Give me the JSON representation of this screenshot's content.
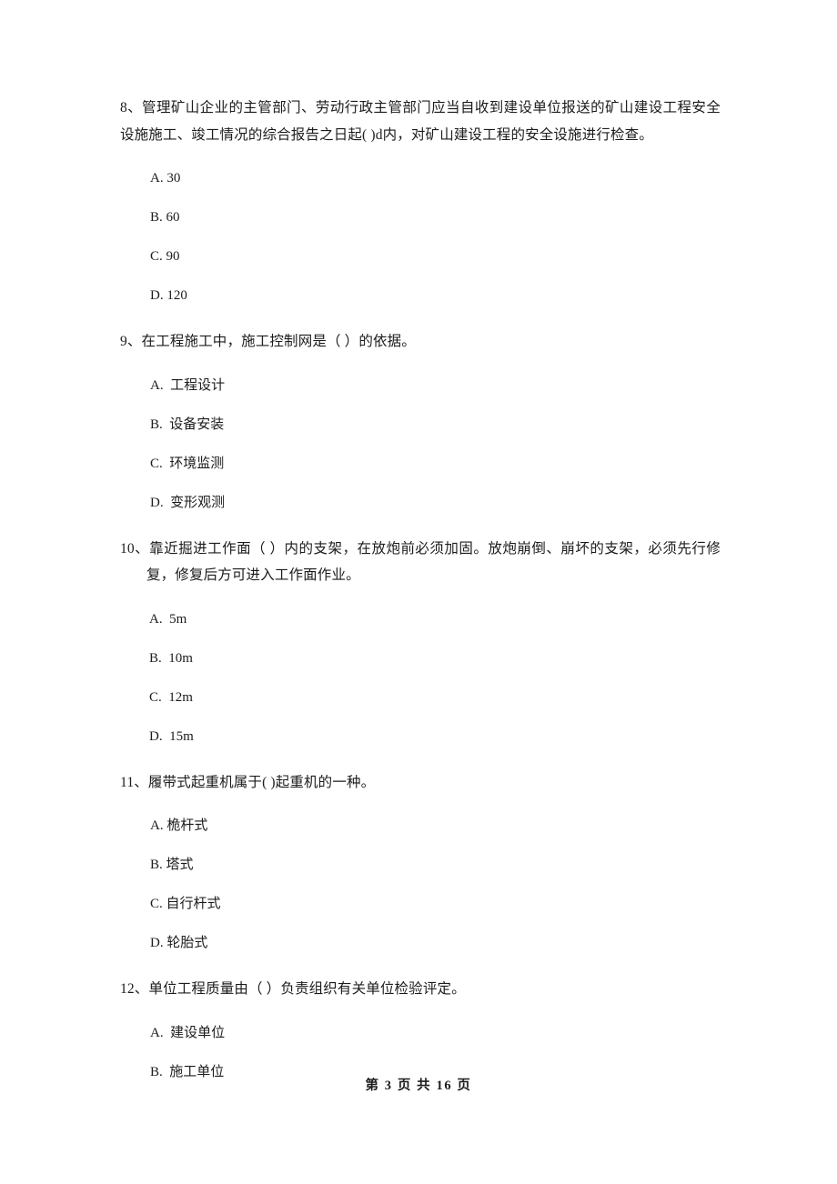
{
  "document": {
    "page_label": "第 3 页 共 16 页",
    "page_number": "3",
    "total_pages": "16",
    "text_color": "#1c1c1c",
    "background_color": "#ffffff"
  },
  "questions": [
    {
      "id": "q8",
      "number": "8、",
      "stem": "8、管理矿山企业的主管部门、劳动行政主管部门应当自收到建设单位报送的矿山建设工程安全设施施工、竣工情况的综合报告之日起(      )d内，对矿山建设工程的安全设施进行检查。",
      "hanging": false,
      "options": [
        {
          "key": "A",
          "label": "A. 30"
        },
        {
          "key": "B",
          "label": "B. 60"
        },
        {
          "key": "C",
          "label": "C. 90"
        },
        {
          "key": "D",
          "label": "D. 120"
        }
      ]
    },
    {
      "id": "q9",
      "number": "9、",
      "stem": "9、在工程施工中，施工控制网是（      ）的依据。",
      "hanging": false,
      "options": [
        {
          "key": "A",
          "label": "A.  工程设计"
        },
        {
          "key": "B",
          "label": "B.  设备安装"
        },
        {
          "key": "C",
          "label": "C.  环境监测"
        },
        {
          "key": "D",
          "label": "D.  变形观测"
        }
      ]
    },
    {
      "id": "q10",
      "number": "10、",
      "stem": "10、靠近掘进工作面（      ）内的支架，在放炮前必须加固。放炮崩倒、崩坏的支架，必须先行修复，修复后方可进入工作面作业。",
      "hanging": true,
      "options": [
        {
          "key": "A",
          "label": "A.  5m"
        },
        {
          "key": "B",
          "label": "B.  10m"
        },
        {
          "key": "C",
          "label": "C.  12m"
        },
        {
          "key": "D",
          "label": "D.  15m"
        }
      ]
    },
    {
      "id": "q11",
      "number": "11、",
      "stem": "11、履带式起重机属于(      )起重机的一种。",
      "hanging": false,
      "options": [
        {
          "key": "A",
          "label": "A. 桅杆式"
        },
        {
          "key": "B",
          "label": "B. 塔式"
        },
        {
          "key": "C",
          "label": "C. 自行杆式"
        },
        {
          "key": "D",
          "label": "D. 轮胎式"
        }
      ]
    },
    {
      "id": "q12",
      "number": "12、",
      "stem": "12、单位工程质量由（      ）负责组织有关单位检验评定。",
      "hanging": false,
      "options": [
        {
          "key": "A",
          "label": "A.  建设单位"
        },
        {
          "key": "B",
          "label": "B.  施工单位"
        }
      ]
    }
  ]
}
